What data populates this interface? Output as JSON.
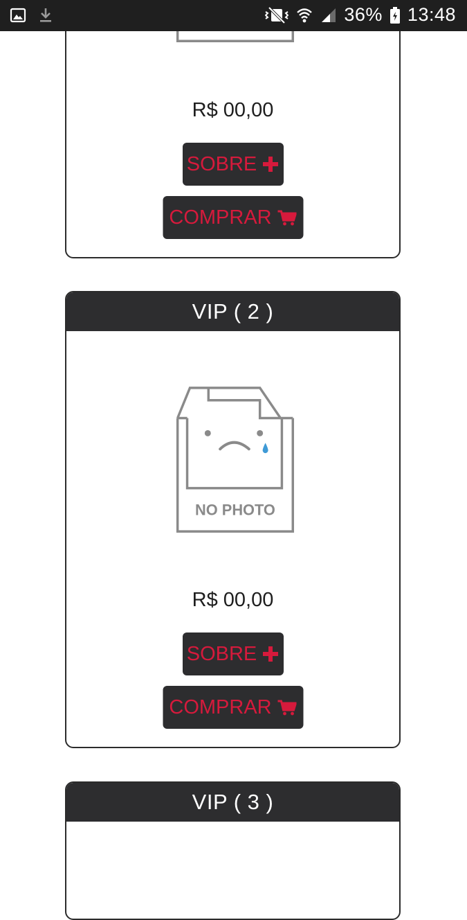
{
  "status_bar": {
    "battery": "36%",
    "time": "13:48"
  },
  "cards": [
    {
      "price": "R$ 00,00",
      "sobre_label": "SOBRE",
      "comprar_label": "COMPRAR"
    },
    {
      "title": "VIP ( 2 )",
      "no_photo_text": "NO PHOTO",
      "price": "R$ 00,00",
      "sobre_label": "SOBRE",
      "comprar_label": "COMPRAR"
    },
    {
      "title": "VIP ( 3 )"
    }
  ],
  "colors": {
    "accent_red": "#d61a3c",
    "dark": "#2d2d2f"
  }
}
